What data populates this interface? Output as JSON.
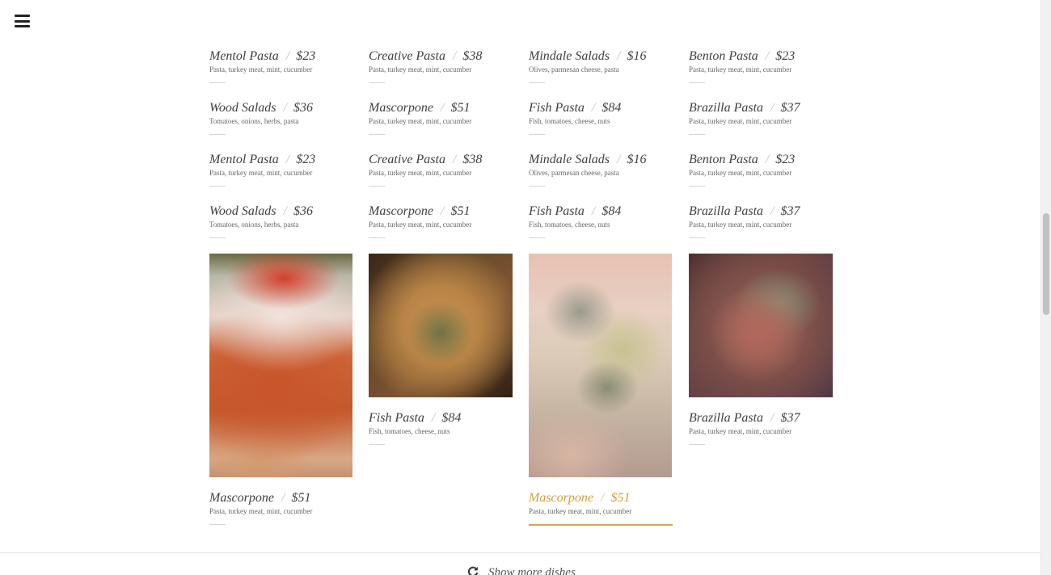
{
  "nav": {
    "menu_icon": "hamburger-menu-icon"
  },
  "grid_rows": [
    [
      {
        "name": "Mentol Pasta",
        "price": "$23",
        "desc": "Pasta, turkey meat, mint, cucumber"
      },
      {
        "name": "Creative Pasta",
        "price": "$38",
        "desc": "Pasta, turkey meat, mint, cucumber"
      },
      {
        "name": "Mindale Salads",
        "price": "$16",
        "desc": "Olives, parmesan cheese, pasta"
      },
      {
        "name": "Benton Pasta",
        "price": "$23",
        "desc": "Pasta, turkey meat, mint, cucumber"
      }
    ],
    [
      {
        "name": "Wood Salads",
        "price": "$36",
        "desc": "Tomatoes, onions, herbs, pasta"
      },
      {
        "name": "Mascorpone",
        "price": "$51",
        "desc": "Pasta, turkey meat, mint, cucumber"
      },
      {
        "name": "Fish Pasta",
        "price": "$84",
        "desc": "Fish, tomatoes, cheese, nuts"
      },
      {
        "name": "Brazilla Pasta",
        "price": "$37",
        "desc": "Pasta, turkey meat, mint, cucumber"
      }
    ],
    [
      {
        "name": "Mentol Pasta",
        "price": "$23",
        "desc": "Pasta, turkey meat, mint, cucumber"
      },
      {
        "name": "Creative Pasta",
        "price": "$38",
        "desc": "Pasta, turkey meat, mint, cucumber"
      },
      {
        "name": "Mindale Salads",
        "price": "$16",
        "desc": "Olives, parmesan cheese, pasta"
      },
      {
        "name": "Benton Pasta",
        "price": "$23",
        "desc": "Pasta, turkey meat, mint, cucumber"
      }
    ],
    [
      {
        "name": "Wood Salads",
        "price": "$36",
        "desc": "Tomatoes, onions, herbs, pasta"
      },
      {
        "name": "Mascorpone",
        "price": "$51",
        "desc": "Pasta, turkey meat, mint, cucumber"
      },
      {
        "name": "Fish Pasta",
        "price": "$84",
        "desc": "Fish, tomatoes, cheese, nuts"
      },
      {
        "name": "Brazilla Pasta",
        "price": "$37",
        "desc": "Pasta, turkey meat, mint, cucumber"
      }
    ]
  ],
  "photo_items": [
    {
      "name": "Mascorpone",
      "price": "$51",
      "desc": "Pasta, turkey meat, mint, cucumber",
      "active": false
    },
    {
      "name": "Fish Pasta",
      "price": "$84",
      "desc": "Fish, tomatoes, cheese, nuts",
      "active": false
    },
    {
      "name": "Mascorpone",
      "price": "$51",
      "desc": "Pasta, turkey meat, mint, cucumber",
      "active": true
    },
    {
      "name": "Brazilla Pasta",
      "price": "$37",
      "desc": "Pasta, turkey meat, mint, cucumber",
      "active": false
    }
  ],
  "separator": "/",
  "more_button": {
    "label": "Show more dishes",
    "icon": "refresh-icon"
  },
  "colors": {
    "accent": "#d1a035",
    "text": "#3f3f3f",
    "muted": "#666666"
  }
}
